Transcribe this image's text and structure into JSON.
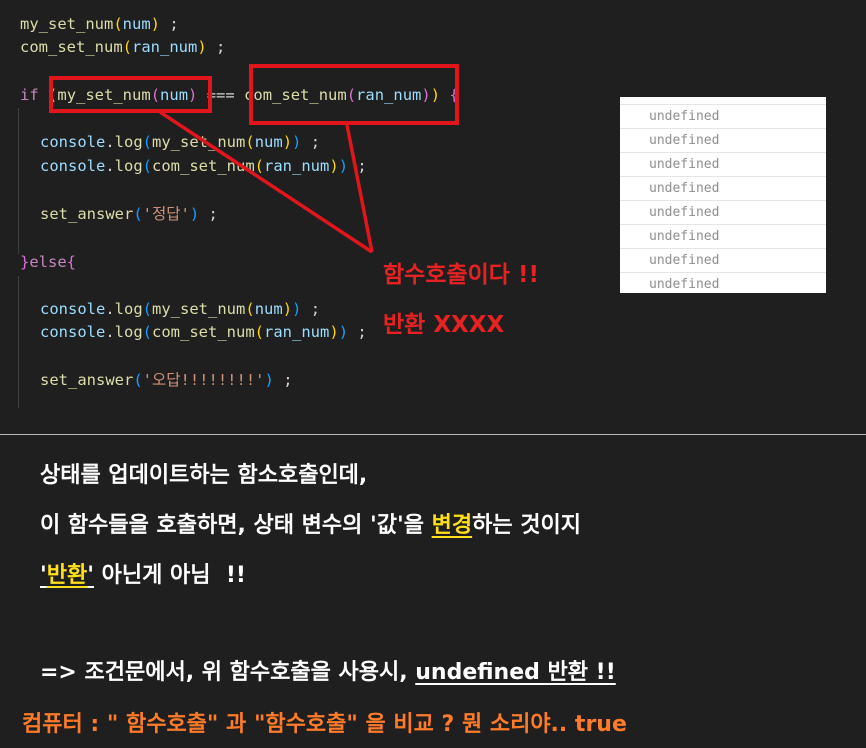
{
  "code": {
    "l1": {
      "fn": "my_set_num",
      "arg": "num",
      "tail": " ;"
    },
    "l2": {
      "fn": "com_set_num",
      "arg": "ran_num",
      "tail": " ;"
    },
    "if_kw": "if",
    "eq_op": " === ",
    "l4a": {
      "obj": "console",
      "dot": ".",
      "fn": "log",
      "inner_fn": "my_set_num",
      "arg": "num",
      "tail": " ;"
    },
    "l4b": {
      "obj": "console",
      "dot": ".",
      "fn": "log",
      "inner_fn": "com_set_num",
      "arg": "ran_num",
      "tail": " ;"
    },
    "set1": {
      "fn": "set_answer",
      "str": "'정답'",
      "tail": " ;"
    },
    "else_kw": "else",
    "l6a": {
      "obj": "console",
      "dot": ".",
      "fn": "log",
      "inner_fn": "my_set_num",
      "arg": "num",
      "tail": " ;"
    },
    "l6b": {
      "obj": "console",
      "dot": ".",
      "fn": "log",
      "inner_fn": "com_set_num",
      "arg": "ran_num",
      "tail": " ;"
    },
    "set2": {
      "fn": "set_answer",
      "str": "'오답!!!!!!!!'",
      "tail": " ;"
    }
  },
  "annotation": {
    "line1": "함수호출이다 !!",
    "line2": "반환 XXXX"
  },
  "console": {
    "rows": [
      "",
      "undefined",
      "undefined",
      "undefined",
      "undefined",
      "undefined",
      "undefined",
      "undefined",
      "undefined"
    ]
  },
  "notes": {
    "n1": "상태를 업데이트하는 함소호출인데,",
    "n2_pre": "이 함수들을 호출하면, 상태 변수의 '값'을 ",
    "n2_hl": "변경",
    "n2_post": "하는 것이지",
    "n3_q1": "'",
    "n3_hl": "반환",
    "n3_q2": "'",
    "n3_post": " 아닌게 아님  !!",
    "n4_pre": "=> 조건문에서, 위 함수호출을 사용시, ",
    "n4_ul": "undefined 반환 !!",
    "n5": "컴퓨터 : \" 함수호출\" 과 \"함수호출\" 을 비교 ? 뭔 소리야.. true"
  },
  "colors": {
    "highlight_box": "#e0161c",
    "annotation_text": "#e62222",
    "emphasis_yellow": "#ffe01a",
    "footer_orange": "#ff7b29"
  }
}
